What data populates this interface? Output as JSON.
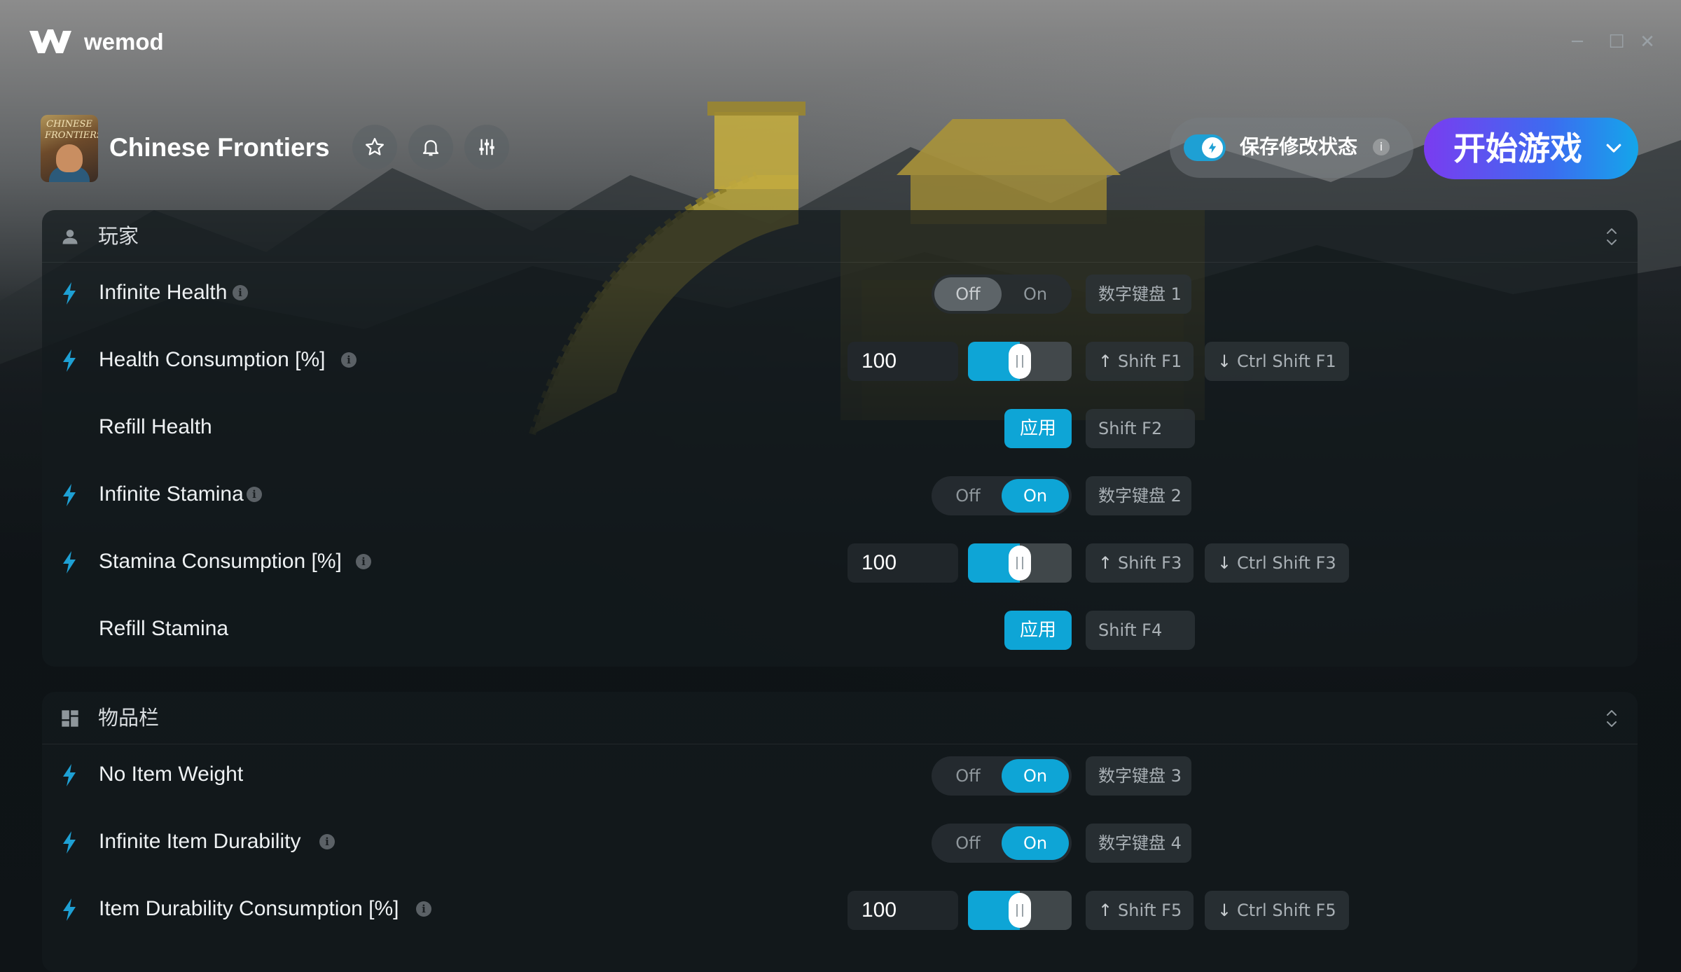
{
  "app": {
    "name": "wemod"
  },
  "window": {
    "minimize": "─",
    "maximize": "☐",
    "close": "✕"
  },
  "game": {
    "title": "Chinese Frontiers",
    "thumb_text": "CHINESE FRONTIERS"
  },
  "save_mods": {
    "label": "保存修改状态",
    "info": "i"
  },
  "play": {
    "label": "开始游戏"
  },
  "sections": [
    {
      "title": "玩家",
      "rows": [
        {
          "label": "Infinite Health",
          "info": "i",
          "control": "toggle",
          "off": "Off",
          "on": "On",
          "state": "off",
          "hotkeys": [
            "数字键盘 1"
          ]
        },
        {
          "label": "Health Consumption [%]",
          "info": "i",
          "control": "slider",
          "value": "100",
          "fraction": 0.5,
          "hotkeys": [
            "Shift F1",
            "Ctrl Shift F1"
          ]
        },
        {
          "label": "Refill Health",
          "control": "apply",
          "button": "应用",
          "hotkeys": [
            "Shift F2"
          ]
        },
        {
          "label": "Infinite Stamina",
          "info": "i",
          "control": "toggle",
          "off": "Off",
          "on": "On",
          "state": "on",
          "hotkeys": [
            "数字键盘 2"
          ]
        },
        {
          "label": "Stamina Consumption [%]",
          "info": "i",
          "control": "slider",
          "value": "100",
          "fraction": 0.5,
          "hotkeys": [
            "Shift F3",
            "Ctrl Shift F3"
          ]
        },
        {
          "label": "Refill Stamina",
          "control": "apply",
          "button": "应用",
          "hotkeys": [
            "Shift F4"
          ]
        }
      ]
    },
    {
      "title": "物品栏",
      "rows": [
        {
          "label": "No Item Weight",
          "control": "toggle",
          "off": "Off",
          "on": "On",
          "state": "on",
          "hotkeys": [
            "数字键盘 3"
          ]
        },
        {
          "label": "Infinite Item Durability",
          "info": "i",
          "control": "toggle",
          "off": "Off",
          "on": "On",
          "state": "on",
          "hotkeys": [
            "数字键盘 4"
          ]
        },
        {
          "label": "Item Durability Consumption [%]",
          "info": "i",
          "control": "slider",
          "value": "100",
          "fraction": 0.5,
          "hotkeys": [
            "Shift F5",
            "Ctrl Shift F5"
          ]
        }
      ]
    }
  ],
  "colors": {
    "accent": "#0ea5d6",
    "play_start": "#7a3cf0",
    "play_end": "#14a6ea",
    "bolt": "#1ea0d4"
  }
}
